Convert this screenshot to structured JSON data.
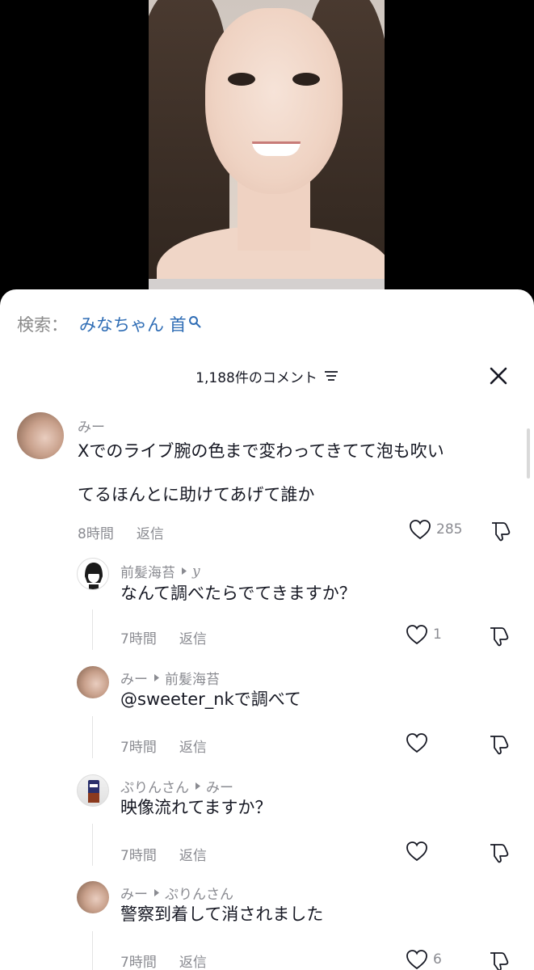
{
  "search": {
    "label": "検索：",
    "term": "みなちゃん 首"
  },
  "comments_header": {
    "title": "1,188件のコメント"
  },
  "comments": [
    {
      "user": "みー",
      "text_line1": "Xでのライブ腕の色まで変わってきてて泡も吹い",
      "text_line2": "てるほんとに助けてあげて誰か",
      "time": "8時間",
      "reply": "返信",
      "likes": "285"
    },
    {
      "user": "前髪海苔",
      "reply_to": "y",
      "text": "なんて調べたらでてきますか？",
      "time": "7時間",
      "reply": "返信",
      "likes": "1"
    },
    {
      "user": "みー",
      "reply_to": "前髪海苔",
      "text": "@sweeter_nkで調べて",
      "time": "7時間",
      "reply": "返信",
      "likes": ""
    },
    {
      "user": "ぷりんさん",
      "reply_to": "みー",
      "text": "映像流れてますか？",
      "time": "7時間",
      "reply": "返信",
      "likes": ""
    },
    {
      "user": "みー",
      "reply_to": "ぷりんさん",
      "text": "警察到着して消されました",
      "time": "7時間",
      "reply": "返信",
      "likes": "6"
    }
  ],
  "colors": {
    "link": "#2f6db5",
    "muted": "#8a8b91",
    "text": "#161823"
  },
  "icons": [
    "search-icon",
    "filter-icon",
    "close-icon",
    "heart-icon",
    "dislike-icon",
    "reply-arrow-icon"
  ]
}
